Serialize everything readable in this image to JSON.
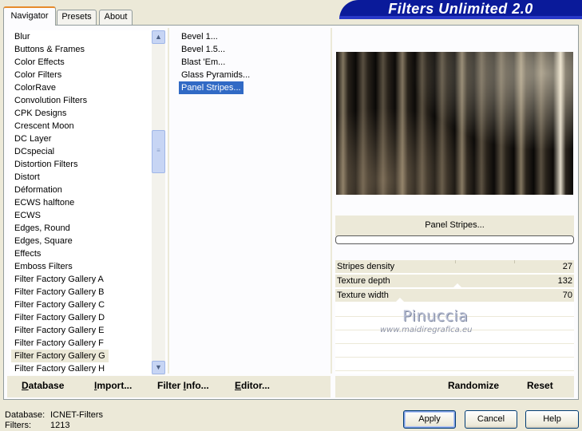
{
  "tabs": [
    "Navigator",
    "Presets",
    "About"
  ],
  "app_title": "Filters Unlimited 2.0",
  "categories": [
    "Blur",
    "Buttons & Frames",
    "Color Effects",
    "Color Filters",
    "ColorRave",
    "Convolution Filters",
    "CPK Designs",
    "Crescent Moon",
    "DC Layer",
    "DCspecial",
    "Distortion Filters",
    "Distort",
    "Déformation",
    "ECWS halftone",
    "ECWS",
    "Edges, Round",
    "Edges, Square",
    "Effects",
    "Emboss Filters",
    "Filter Factory Gallery A",
    "Filter Factory Gallery B",
    "Filter Factory Gallery C",
    "Filter Factory Gallery D",
    "Filter Factory Gallery E",
    "Filter Factory Gallery F",
    "Filter Factory Gallery G",
    "Filter Factory Gallery H"
  ],
  "selected_category": "Filter Factory Gallery G",
  "filters": [
    "Bevel 1...",
    "Bevel 1.5...",
    "Blast 'Em...",
    "Glass Pyramids...",
    "Panel Stripes..."
  ],
  "selected_filter": "Panel Stripes...",
  "preview": {
    "filter_name": "Panel Stripes..."
  },
  "parameters": [
    {
      "label": "Stripes density",
      "value": "27"
    },
    {
      "label": "Texture depth",
      "value": "132"
    },
    {
      "label": "Texture width",
      "value": "70"
    }
  ],
  "watermark": {
    "line1": "Pinuccia",
    "line2": "www.maidiregrafica.eu"
  },
  "left_buttons": [
    {
      "underline": "D",
      "rest": "atabase"
    },
    {
      "underline": "I",
      "rest": "mport..."
    },
    {
      "underline": "",
      "rest": "Filter ",
      "underline2": "I",
      "rest2": "nfo..."
    },
    {
      "underline": "E",
      "rest": "ditor..."
    }
  ],
  "right_buttons": [
    "Randomize",
    "Reset"
  ],
  "footer": {
    "database_label": "Database:",
    "database_value": "ICNET-Filters",
    "filters_label": "Filters:",
    "filters_value": "1213"
  },
  "dialog_buttons": {
    "apply": "Apply",
    "cancel": "Cancel",
    "help": "Help"
  },
  "colors": {
    "banner": "#0a1a9a",
    "selection": "#316ac5",
    "face": "#ece9d8"
  }
}
